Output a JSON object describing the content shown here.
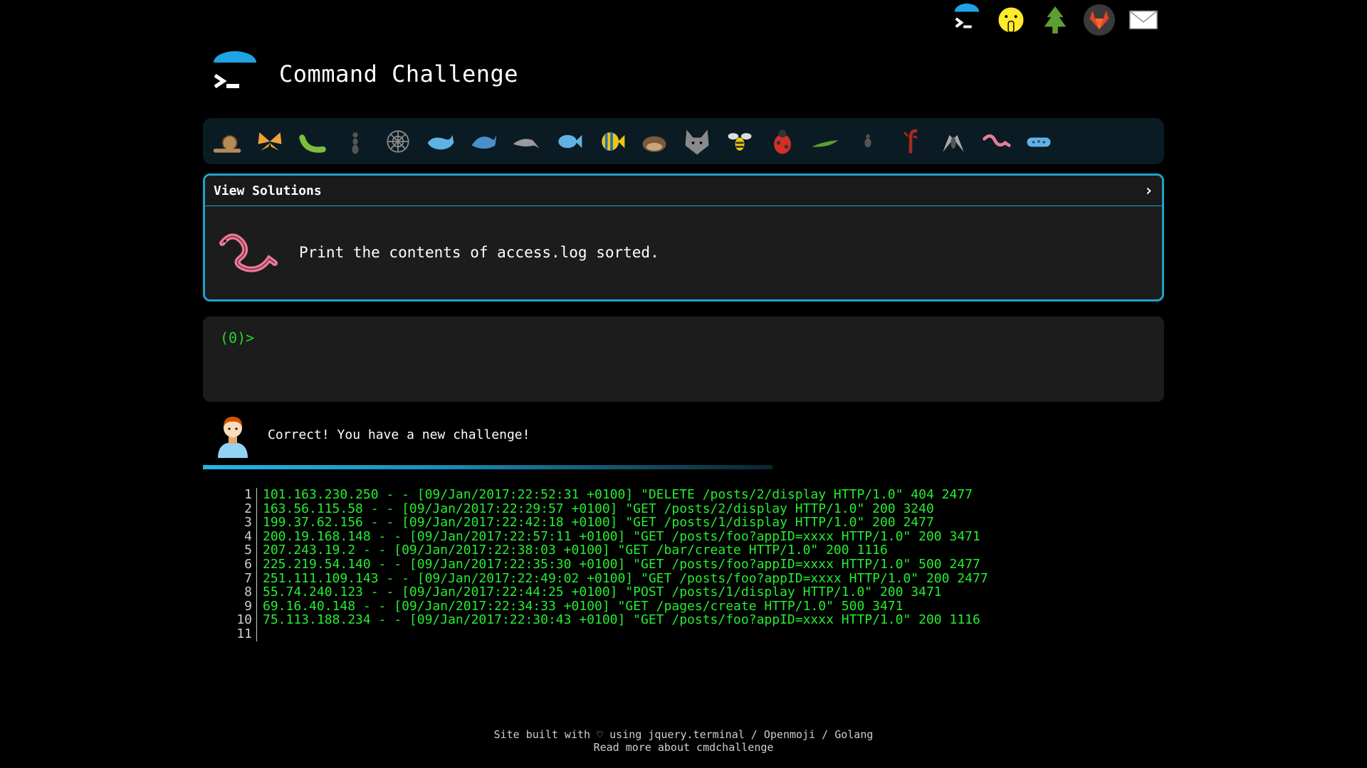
{
  "top_nav": {
    "icons": [
      "terminal-logo-icon",
      "shushing-face-icon",
      "tree-icon",
      "gitlab-icon",
      "mail-icon"
    ]
  },
  "header": {
    "title": "Command Challenge"
  },
  "challenge_strip": {
    "icons": [
      "snail-icon",
      "butterfly-icon",
      "caterpillar-icon",
      "ant-icon",
      "spider-web-icon",
      "whale-icon",
      "shark-icon",
      "dolphin-icon",
      "fish-icon",
      "tropical-fish-icon",
      "hedgehog-icon",
      "wolf-icon",
      "bee-icon",
      "ladybug-icon",
      "cricket-icon",
      "spider-icon",
      "scorpion-icon",
      "fly-icon",
      "worm-icon",
      "microbe-icon"
    ]
  },
  "solutions": {
    "title": "View Solutions",
    "chevron": "›",
    "challenge_text": "Print the contents of access.log sorted."
  },
  "terminal": {
    "prompt": "(0)>"
  },
  "result": {
    "message": "Correct! You have a new challenge!"
  },
  "output": {
    "lines": [
      {
        "n": "1",
        "t": "101.163.230.250 - - [09/Jan/2017:22:52:31 +0100] \"DELETE /posts/2/display HTTP/1.0\" 404 2477"
      },
      {
        "n": "2",
        "t": "163.56.115.58 - - [09/Jan/2017:22:29:57 +0100] \"GET /posts/2/display HTTP/1.0\" 200 3240"
      },
      {
        "n": "3",
        "t": "199.37.62.156 - - [09/Jan/2017:22:42:18 +0100] \"GET /posts/1/display HTTP/1.0\" 200 2477"
      },
      {
        "n": "4",
        "t": "200.19.168.148 - - [09/Jan/2017:22:57:11 +0100] \"GET /posts/foo?appID=xxxx HTTP/1.0\" 200 3471"
      },
      {
        "n": "5",
        "t": "207.243.19.2 - - [09/Jan/2017:22:38:03 +0100] \"GET /bar/create HTTP/1.0\" 200 1116"
      },
      {
        "n": "6",
        "t": "225.219.54.140 - - [09/Jan/2017:22:35:30 +0100] \"GET /posts/foo?appID=xxxx HTTP/1.0\" 500 2477"
      },
      {
        "n": "7",
        "t": "251.111.109.143 - - [09/Jan/2017:22:49:02 +0100] \"GET /posts/foo?appID=xxxx HTTP/1.0\" 200 2477"
      },
      {
        "n": "8",
        "t": "55.74.240.123 - - [09/Jan/2017:22:44:25 +0100] \"POST /posts/1/display HTTP/1.0\" 200 3471"
      },
      {
        "n": "9",
        "t": "69.16.40.148 - - [09/Jan/2017:22:34:33 +0100] \"GET /pages/create HTTP/1.0\" 500 3471"
      },
      {
        "n": "10",
        "t": "75.113.188.234 - - [09/Jan/2017:22:30:43 +0100] \"GET /posts/foo?appID=xxxx HTTP/1.0\" 200 1116"
      },
      {
        "n": "11",
        "t": ""
      }
    ]
  },
  "footer": {
    "line1": "Site built with ♡ using jquery.terminal / Openmoji / Golang",
    "line2": "Read more about cmdchallenge"
  },
  "colors": {
    "accent": "#1ea3c9",
    "terminal_green": "#25ee30",
    "panel_bg": "#1c1c1c"
  }
}
